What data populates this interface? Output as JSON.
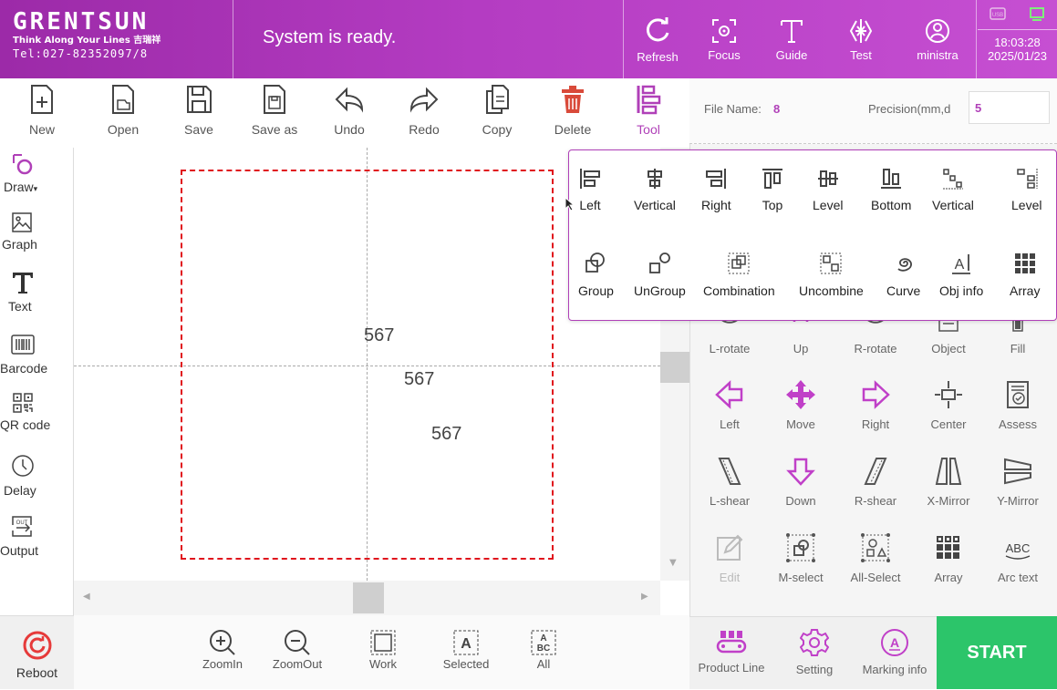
{
  "app": {
    "logo_text": "GRENTSUN",
    "tagline": "Think Along Your Lines 吉瑞祥",
    "phone": "Tel:027-82352097/8",
    "status": "System is ready.",
    "time": "18:03:28",
    "date": "2025/01/23",
    "brand_color": "#b43cc2",
    "accent_color": "#c040c8",
    "start_color": "#2cc56a"
  },
  "top_buttons": [
    {
      "label": "Refresh",
      "icon": "refresh-icon"
    },
    {
      "label": "Focus",
      "icon": "focus-icon"
    },
    {
      "label": "Guide",
      "icon": "guide-icon"
    },
    {
      "label": "Test",
      "icon": "test-icon"
    },
    {
      "label": "ministra",
      "icon": "user-icon"
    }
  ],
  "toolbar": [
    {
      "label": "New",
      "icon": "new-file-icon"
    },
    {
      "label": "Open",
      "icon": "open-file-icon"
    },
    {
      "label": "Save",
      "icon": "save-icon"
    },
    {
      "label": "Save as",
      "icon": "save-as-icon"
    },
    {
      "label": "Undo",
      "icon": "undo-icon"
    },
    {
      "label": "Redo",
      "icon": "redo-icon"
    },
    {
      "label": "Copy",
      "icon": "copy-icon"
    },
    {
      "label": "Delete",
      "icon": "delete-icon"
    },
    {
      "label": "Tool",
      "icon": "tool-icon"
    }
  ],
  "left_tools": [
    {
      "label": "Draw",
      "icon": "draw-icon"
    },
    {
      "label": "Graph",
      "icon": "graph-icon"
    },
    {
      "label": "Text",
      "icon": "text-icon"
    },
    {
      "label": "Barcode",
      "icon": "barcode-icon"
    },
    {
      "label": "QR code",
      "icon": "qr-code-icon"
    },
    {
      "label": "Delay",
      "icon": "delay-icon"
    },
    {
      "label": "Output",
      "icon": "output-icon"
    }
  ],
  "reboot_label": "Reboot",
  "canvas_texts": [
    "567",
    "567",
    "567"
  ],
  "bottom_buttons": [
    {
      "label": "ZoomIn",
      "icon": "zoom-in-icon"
    },
    {
      "label": "ZoomOut",
      "icon": "zoom-out-icon"
    },
    {
      "label": "Work",
      "icon": "work-area-icon"
    },
    {
      "label": "Selected",
      "icon": "selected-icon"
    },
    {
      "label": "All",
      "icon": "all-icon"
    }
  ],
  "file_info": {
    "file_name_label": "File Name:",
    "file_name_value": "8",
    "precision_label": "Precision(mm,d",
    "precision_value": "5"
  },
  "right_grid": [
    [
      "L-rotate",
      "Up",
      "R-rotate",
      "Object",
      "Fill"
    ],
    [
      "Left",
      "Move",
      "Right",
      "Center",
      "Assess"
    ],
    [
      "L-shear",
      "Down",
      "R-shear",
      "X-Mirror",
      "Y-Mirror"
    ],
    [
      "Edit",
      "M-select",
      "All-Select",
      "Array",
      "Arc text"
    ]
  ],
  "right_bottom": [
    {
      "label": "Product Line",
      "icon": "product-line-icon"
    },
    {
      "label": "Setting",
      "icon": "setting-icon"
    },
    {
      "label": "Marking info",
      "icon": "marking-info-icon"
    }
  ],
  "start_label": "START",
  "tool_popup": {
    "row1": [
      "Left",
      "Vertical",
      "Right",
      "Top",
      "Level",
      "Bottom",
      "Vertical",
      "Level"
    ],
    "row2": [
      "Group",
      "UnGroup",
      "Combination",
      "Uncombine",
      "Curve",
      "Obj info",
      "Array"
    ]
  }
}
